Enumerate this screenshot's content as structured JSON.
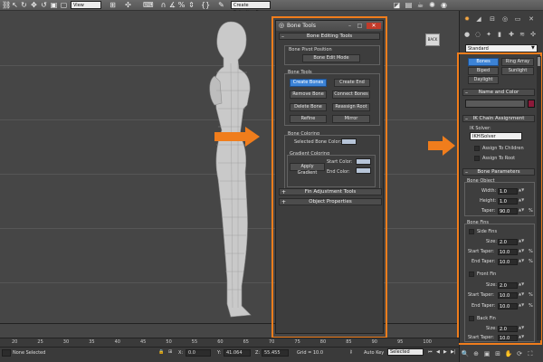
{
  "toolbar": {
    "view_dropdown": "View",
    "selection_set_dropdown": "Create Selection S"
  },
  "viewport": {
    "viewcube_label": "BACK"
  },
  "bone_tools": {
    "title": "Bone Tools",
    "editing_rollout": "Bone Editing Tools",
    "pivot_group": "Bone Pivot Position",
    "bone_edit_mode": "Bone Edit Mode",
    "bone_tools_group": "Bone Tools",
    "create_bones": "Create Bones",
    "create_end": "Create End",
    "remove_bone": "Remove Bone",
    "connect_bones": "Connect Bones",
    "delete_bone": "Delete Bone",
    "reassign_root": "Reassign Root",
    "refine": "Refine",
    "mirror": "Mirror",
    "coloring_group": "Bone Coloring",
    "selected_bone_color": "Selected Bone Color:",
    "gradient_group": "Gradient Coloring",
    "apply_gradient": "Apply Gradient",
    "start_color": "Start Color:",
    "end_color": "End Color:",
    "fin_rollout": "Fin Adjustment Tools",
    "object_rollout": "Object Properties"
  },
  "command_panel": {
    "category_dropdown": "Standard",
    "object_types": [
      "Bones",
      "Ring Array",
      "Biped",
      "Sunlight",
      "Daylight"
    ],
    "name_color_rollout": "Name and Color",
    "name_color_swatch": "#8b1a3a",
    "ik_rollout": "IK Chain Assignment",
    "ik_solver_label": "IK Solver:",
    "ik_solver_value": "IKHISolver",
    "assign_to_children": "Assign To Children",
    "assign_to_root": "Assign To Root",
    "bone_params_rollout": "Bone Parameters",
    "bone_object_group": "Bone Object",
    "width_label": "Width:",
    "width_value": "1.0",
    "height_label": "Height:",
    "height_value": "1.0",
    "taper_label": "Taper:",
    "taper_value": "90.0",
    "bone_fins_group": "Bone Fins",
    "side_fins": "Side Fins",
    "front_fin": "Front Fin",
    "back_fin": "Back Fin",
    "size_label": "Size:",
    "start_taper_label": "Start Taper:",
    "end_taper_label": "End Taper:",
    "fin_size_value": "2.0",
    "fin_taper_value": "10.0",
    "percent": "%"
  },
  "timeline": {
    "ticks": [
      "20",
      "25",
      "30",
      "35",
      "40",
      "45",
      "50",
      "55",
      "60",
      "65",
      "70",
      "75",
      "80",
      "85",
      "90",
      "95",
      "100"
    ]
  },
  "status": {
    "selection": "None Selected",
    "x_label": "X:",
    "x_value": "0.0",
    "y_label": "Y:",
    "y_value": "41.064",
    "z_label": "Z:",
    "z_value": "55.455",
    "grid": "Grid = 10.0",
    "auto_key": "Auto Key",
    "key_mode": "Selected"
  },
  "colors": {
    "highlight_orange": "#f07d1c",
    "active_button": "#3c83d6"
  }
}
